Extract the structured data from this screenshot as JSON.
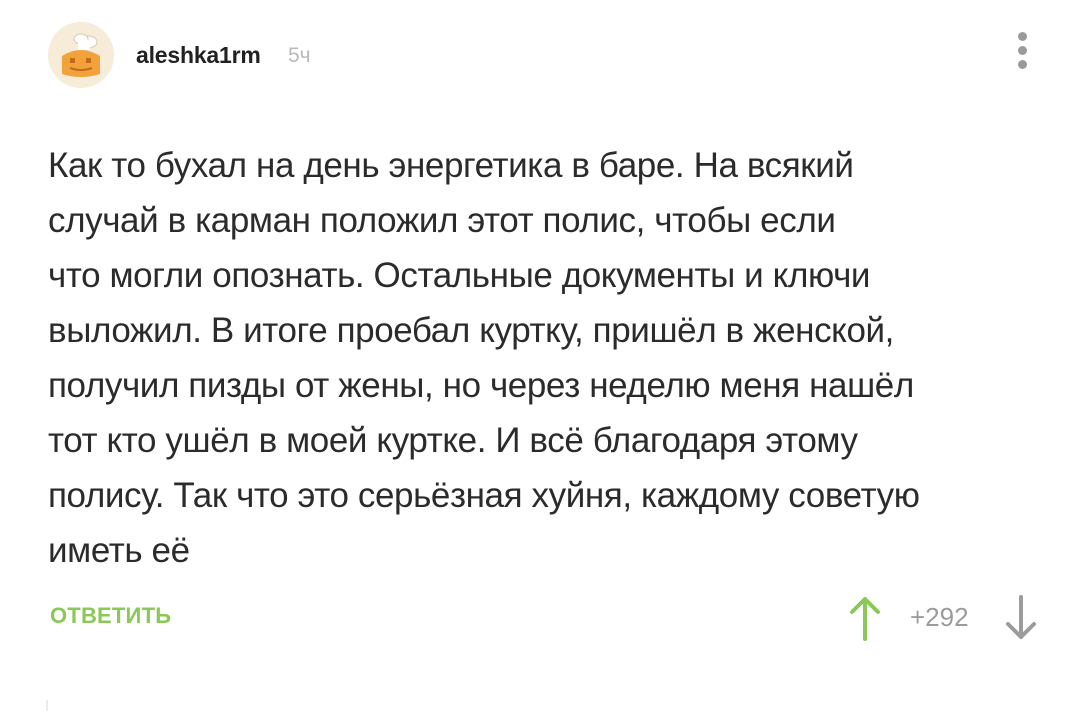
{
  "post": {
    "author": "aleshka1rm",
    "time": "5ч",
    "text": "Как то бухал на день энергетика в баре. На всякий\nслучай в карман положил этот полис, чтобы если\nчто могли опознать. Остальные документы и ключи\nвыложил. В итоге проебал куртку, пришёл в женской,\nполучил пизды от жены, но через неделю меня нашёл\nтот кто ушёл в моей куртке. И всё благодаря этому\nполису. Так что это серьёзная хуйня, каждому советую\nиметь её"
  },
  "actions": {
    "reply_label": "ОТВЕТИТЬ",
    "rating": "+292"
  },
  "icons": {
    "avatar": "cartoon-avatar-icon",
    "menu": "more-vertical-icon",
    "upvote": "arrow-up-icon",
    "downvote": "arrow-down-icon"
  },
  "colors": {
    "accent_green": "#8ac858",
    "muted_gray": "#9c9c9c",
    "text_dark": "#2b2b2b"
  }
}
